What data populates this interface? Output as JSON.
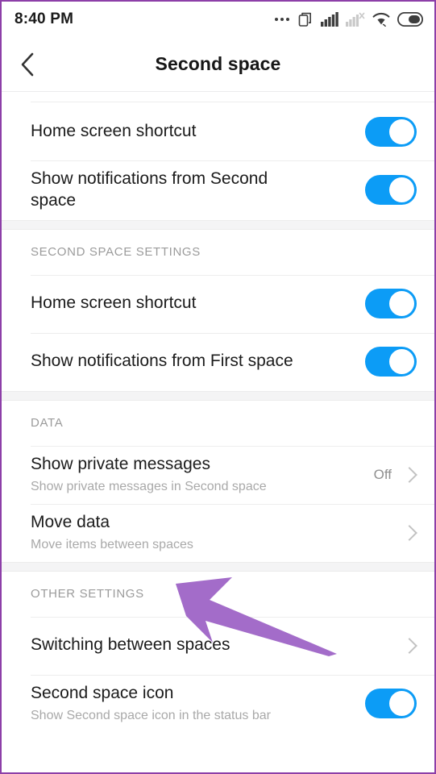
{
  "statusbar": {
    "time": "8:40 PM",
    "icons": [
      {
        "name": "more-dots-icon"
      },
      {
        "name": "second-space-icon"
      },
      {
        "name": "signal-bars-icon"
      },
      {
        "name": "signal-no-service-icon"
      },
      {
        "name": "wifi-icon"
      },
      {
        "name": "battery-icon"
      }
    ]
  },
  "header": {
    "back_icon": "chevron-left-icon",
    "title": "Second space"
  },
  "sections": [
    {
      "id": "first-space-settings",
      "header": null,
      "rows": [
        {
          "id": "home-screen-shortcut-1",
          "title": "Home screen shortcut",
          "subtitle": null,
          "control": "toggle",
          "toggle_on": true,
          "value": null
        },
        {
          "id": "show-notifications-second-space",
          "title": "Show notifications from Second space",
          "subtitle": null,
          "control": "toggle",
          "toggle_on": true,
          "value": null
        }
      ]
    },
    {
      "id": "second-space-settings",
      "header": "SECOND SPACE SETTINGS",
      "rows": [
        {
          "id": "home-screen-shortcut-2",
          "title": "Home screen shortcut",
          "subtitle": null,
          "control": "toggle",
          "toggle_on": true,
          "value": null
        },
        {
          "id": "show-notifications-first-space",
          "title": "Show notifications from First space",
          "subtitle": null,
          "control": "toggle",
          "toggle_on": true,
          "value": null
        }
      ]
    },
    {
      "id": "data",
      "header": "DATA",
      "rows": [
        {
          "id": "show-private-messages",
          "title": "Show private messages",
          "subtitle": "Show private messages in Second space",
          "control": "value-chevron",
          "toggle_on": null,
          "value": "Off"
        },
        {
          "id": "move-data",
          "title": "Move data",
          "subtitle": "Move items between spaces",
          "control": "chevron",
          "toggle_on": null,
          "value": null
        }
      ]
    },
    {
      "id": "other-settings",
      "header": "OTHER SETTINGS",
      "rows": [
        {
          "id": "switching-between-spaces",
          "title": "Switching between spaces",
          "subtitle": null,
          "control": "chevron",
          "toggle_on": null,
          "value": null
        },
        {
          "id": "second-space-icon-row",
          "title": "Second space icon",
          "subtitle": "Show Second space icon in the status bar",
          "control": "toggle",
          "toggle_on": true,
          "value": null
        }
      ]
    }
  ],
  "annotation": {
    "name": "purple-arrow-pointing-to-move-data",
    "color": "#a36cc9"
  },
  "colors": {
    "toggle_on": "#0c9cf6",
    "frame_border": "#8d3fa8",
    "primary_text": "#1b1b1b",
    "secondary_text": "#a9a9a9",
    "section_header_text": "#9b9b9b",
    "band": "#f4f4f5"
  }
}
